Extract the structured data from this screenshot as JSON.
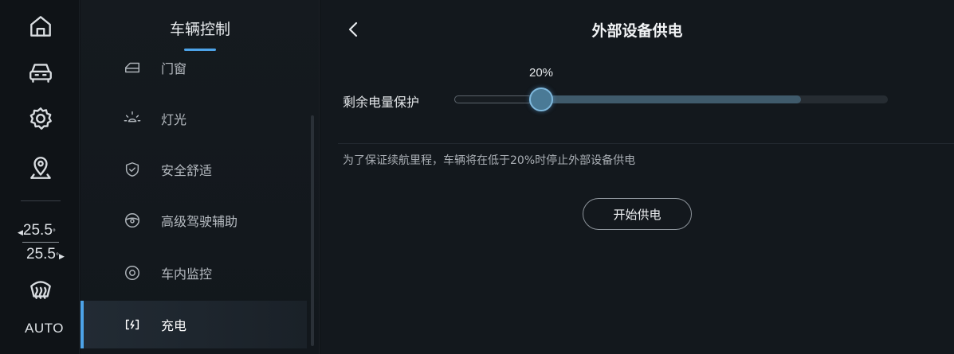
{
  "rail": {
    "icons": [
      "home-icon",
      "car-icon",
      "settings-icon",
      "map-pin-icon",
      "defrost-icon"
    ],
    "temp_left": "25.5",
    "temp_right": "25.5",
    "temp_unit": "°",
    "auto_label": "AUTO"
  },
  "menu": {
    "title": "车辆控制",
    "items": [
      {
        "label": "门窗",
        "icon": "door-icon"
      },
      {
        "label": "灯光",
        "icon": "light-icon"
      },
      {
        "label": "安全舒适",
        "icon": "shield-icon"
      },
      {
        "label": "高级驾驶辅助",
        "icon": "steering-wheel-icon"
      },
      {
        "label": "车内监控",
        "icon": "camera-icon"
      },
      {
        "label": "充电",
        "icon": "charging-icon",
        "active": true
      }
    ]
  },
  "main": {
    "title": "外部设备供电",
    "battery_protection": {
      "label": "剩余电量保护",
      "value_label": "20%",
      "value": 0.2,
      "available_max": 0.8
    },
    "hint": "为了保证续航里程，车辆将在低于20%时停止外部设备供电",
    "start_button": "开始供电"
  },
  "colors": {
    "accent": "#4da3e8",
    "background": "#13181d",
    "slider_fill": "#3f5a6b"
  }
}
